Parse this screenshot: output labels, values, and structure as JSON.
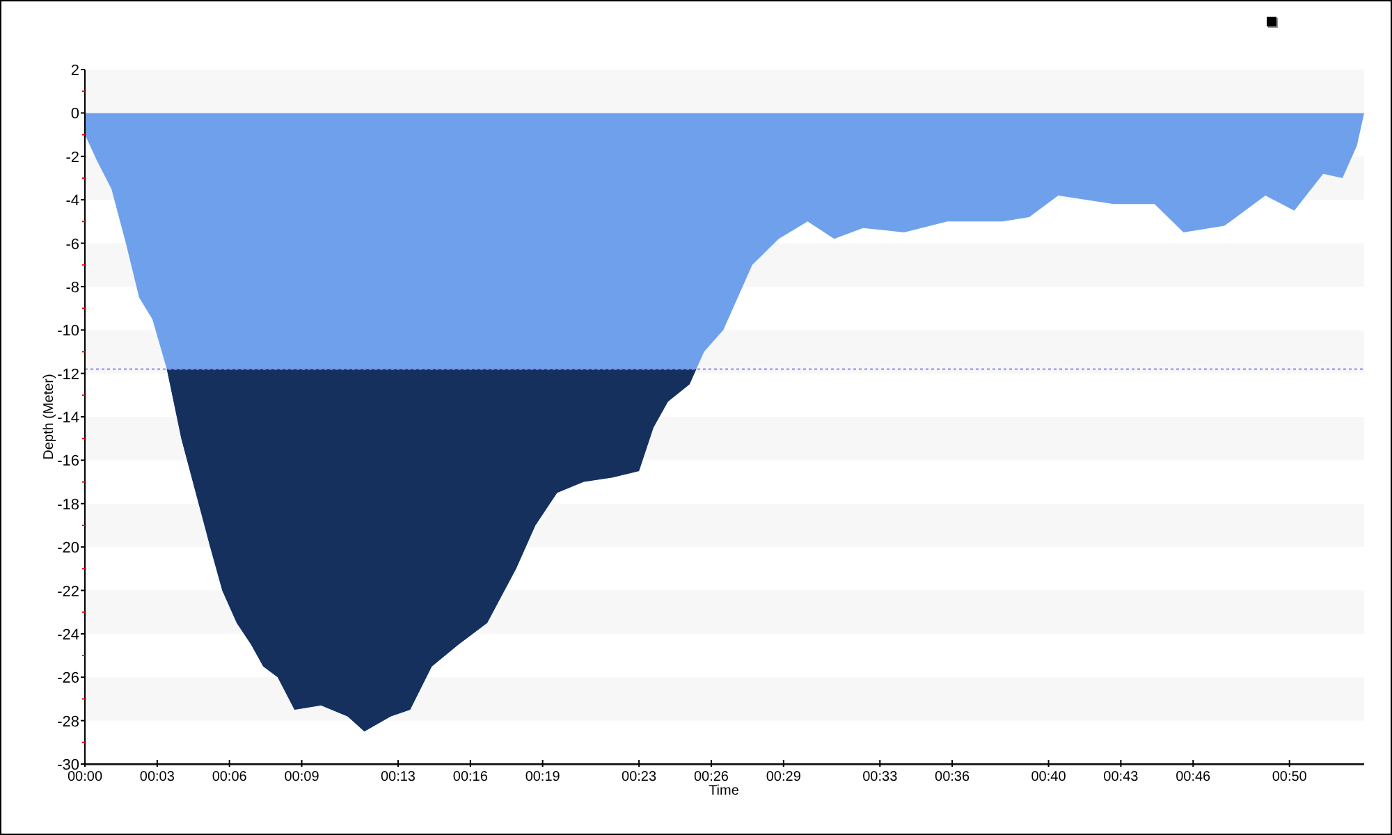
{
  "chart_data": {
    "type": "area",
    "xlabel": "Time",
    "ylabel": "Depth (Meter)",
    "x": [
      0,
      0.5,
      1.1,
      1.7,
      2.25,
      2.8,
      3.4,
      4.0,
      4.6,
      5.2,
      5.7,
      6.3,
      6.9,
      7.4,
      8.0,
      8.7,
      9.8,
      10.9,
      11.6,
      12.7,
      13.5,
      14.4,
      15.5,
      16.7,
      17.9,
      18.7,
      19.6,
      20.7,
      21.9,
      23.0,
      23.6,
      24.2,
      25.1,
      25.7,
      26.5,
      27.7,
      28.8,
      30.0,
      31.1,
      32.3,
      34.0,
      35.8,
      38.1,
      39.2,
      40.4,
      42.7,
      44.4,
      45.6,
      47.3,
      49.0,
      50.2,
      51.4,
      52.2,
      52.8,
      53.1
    ],
    "series": [
      {
        "color": "#6fa0ec",
        "values": [
          -1,
          -2.2,
          -3.5,
          -6,
          -8.5,
          -9.5,
          -11.8,
          -15,
          -17.5,
          -20,
          -22,
          -23.5,
          -24.5,
          -25.5,
          -26,
          -27.5,
          -27.3,
          -27.8,
          -28.5,
          -27.8,
          -27.5,
          -25.5,
          -24.5,
          -23.5,
          -21,
          -19,
          -17.5,
          -17,
          -16.8,
          -16.5,
          -14.5,
          -13.3,
          -12.5,
          -11,
          -10,
          -7,
          -5.8,
          -5,
          -5.8,
          -5.3,
          -5.5,
          -5,
          -5,
          -4.8,
          -3.8,
          -4.2,
          -4.2,
          -5.5,
          -5.2,
          -3.8,
          -4.5,
          -2.8,
          -3,
          -1.5,
          0
        ]
      }
    ],
    "xlim": [
      0,
      53.1
    ],
    "ylim": [
      -30,
      2
    ],
    "xticks": [
      {
        "value": 0,
        "label": "00:00"
      },
      {
        "value": 3,
        "label": "00:03"
      },
      {
        "value": 6,
        "label": "00:06"
      },
      {
        "value": 9,
        "label": "00:09"
      },
      {
        "value": 13,
        "label": "00:13"
      },
      {
        "value": 16,
        "label": "00:16"
      },
      {
        "value": 19,
        "label": "00:19"
      },
      {
        "value": 23,
        "label": "00:23"
      },
      {
        "value": 26,
        "label": "00:26"
      },
      {
        "value": 29,
        "label": "00:29"
      },
      {
        "value": 33,
        "label": "00:33"
      },
      {
        "value": 36,
        "label": "00:36"
      },
      {
        "value": 40,
        "label": "00:40"
      },
      {
        "value": 43,
        "label": "00:43"
      },
      {
        "value": 46,
        "label": "00:46"
      },
      {
        "value": 50,
        "label": "00:50"
      }
    ],
    "yticks": [
      2,
      0,
      -2,
      -4,
      -6,
      -8,
      -10,
      -12,
      -14,
      -16,
      -18,
      -20,
      -22,
      -24,
      -26,
      -28,
      -30
    ],
    "ref_lines": [
      {
        "axis": "y",
        "value": -11.8,
        "color": "#8a8af0"
      }
    ]
  }
}
